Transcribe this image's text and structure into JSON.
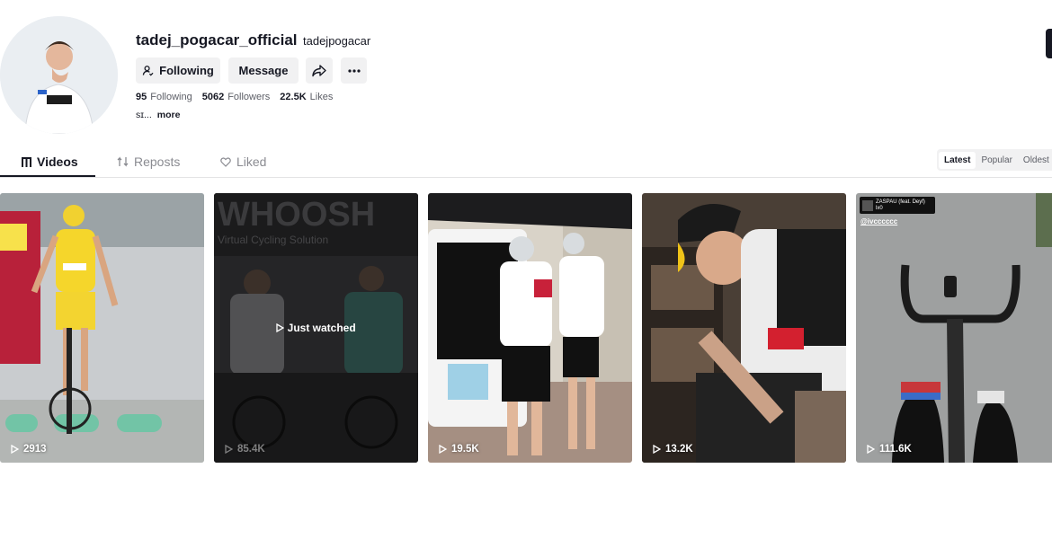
{
  "profile": {
    "username": "tadej_pogacar_official",
    "nickname": "tadejpogacar",
    "following_button": "Following",
    "message_button": "Message",
    "stats": {
      "following_count": "95",
      "following_label": "Following",
      "followers_count": "5062",
      "followers_label": "Followers",
      "likes_count": "22.5K",
      "likes_label": "Likes"
    },
    "bio": "sɪ...",
    "bio_more": "more"
  },
  "tabs": {
    "videos": "Videos",
    "reposts": "Reposts",
    "liked": "Liked"
  },
  "sort": {
    "latest": "Latest",
    "popular": "Popular",
    "oldest": "Oldest"
  },
  "videos": [
    {
      "views": "2913"
    },
    {
      "views": "85.4K",
      "overlay": "Just watched"
    },
    {
      "views": "19.5K"
    },
    {
      "views": "13.2K"
    },
    {
      "views": "111.6K",
      "music": "ZASPAU (feat. Deyf)",
      "music_sub": "lx0",
      "handle": "@ivcccccc"
    }
  ]
}
